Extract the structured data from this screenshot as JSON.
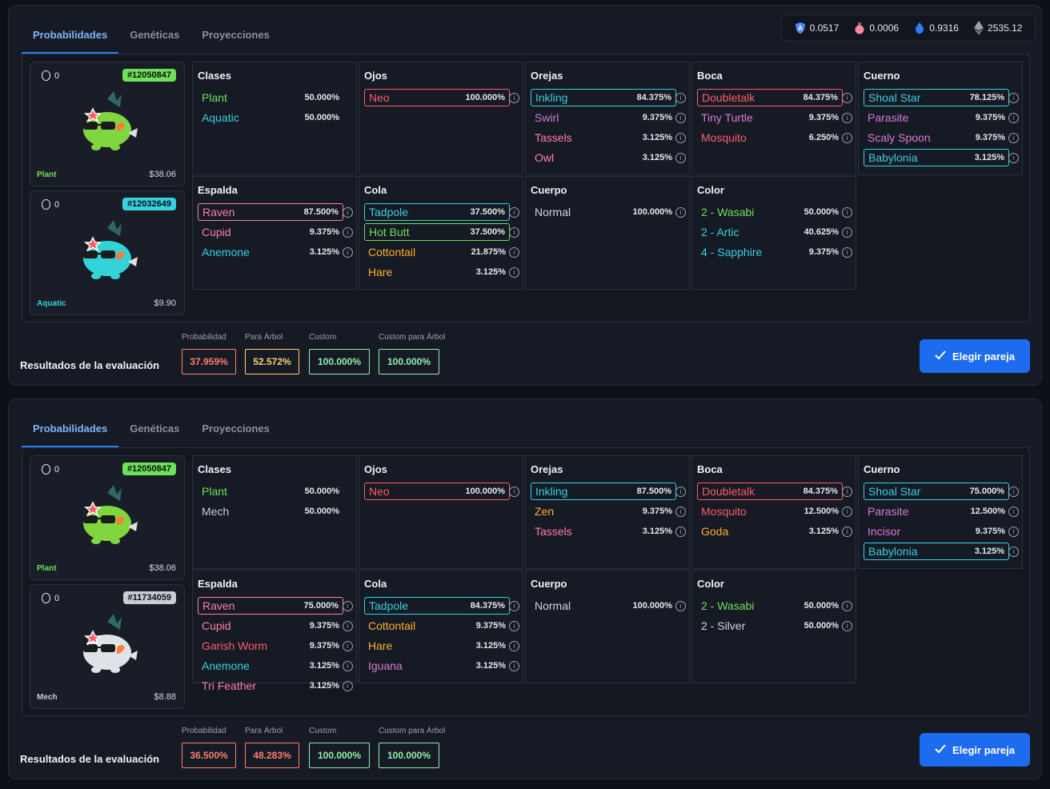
{
  "tokens": [
    {
      "icon": "axs-shield-icon",
      "value": "0.0517",
      "color": "#4a8cff"
    },
    {
      "icon": "slp-potion-icon",
      "value": "0.0006",
      "color": "#f28aa0"
    },
    {
      "icon": "ron-drop-icon",
      "value": "0.9316",
      "color": "#2d7bf0"
    },
    {
      "icon": "eth-diamond-icon",
      "value": "2535.12",
      "color": "#9aa0ad"
    }
  ],
  "colors": {
    "Plant": "#6ee05a",
    "Aquatic": "#36d2e0",
    "Reptile": "#d77ad8",
    "Bird": "#ff7fa8",
    "Beast": "#ffb02e",
    "Bug": "#ff5c66",
    "Mech": "#c9ccd3",
    "Neutral": "#d4d7df",
    "accent": "#2d7bf0"
  },
  "panels": [
    {
      "tabs": [
        "Probabilidades",
        "Genéticas",
        "Proyecciones"
      ],
      "active_tab": 0,
      "axies": [
        {
          "count": "0",
          "id": "#12050847",
          "id_color": "#6ee05a",
          "cls": "Plant",
          "price": "$38.06",
          "body_color": "#7fd63f"
        },
        {
          "count": "0",
          "id": "#12032649",
          "id_color": "#36d2e0",
          "cls": "Aquatic",
          "price": "$9.90",
          "body_color": "#34d3d9"
        }
      ],
      "parts": [
        {
          "title": "Clases",
          "rows": [
            {
              "name": "Plant",
              "pct": "50.000%",
              "cls": "Plant",
              "boxed": false,
              "info": false
            },
            {
              "name": "Aquatic",
              "pct": "50.000%",
              "cls": "Aquatic",
              "boxed": false,
              "info": false
            }
          ]
        },
        {
          "title": "Ojos",
          "rows": [
            {
              "name": "Neo",
              "pct": "100.000%",
              "cls": "Bug",
              "boxed": true,
              "info": true
            }
          ]
        },
        {
          "title": "Orejas",
          "rows": [
            {
              "name": "Inkling",
              "pct": "84.375%",
              "cls": "Aquatic",
              "boxed": true,
              "info": true
            },
            {
              "name": "Swirl",
              "pct": "9.375%",
              "cls": "Reptile",
              "boxed": false,
              "info": true
            },
            {
              "name": "Tassels",
              "pct": "3.125%",
              "cls": "Bird",
              "boxed": false,
              "info": true
            },
            {
              "name": "Owl",
              "pct": "3.125%",
              "cls": "Bird",
              "boxed": false,
              "info": true
            }
          ]
        },
        {
          "title": "Boca",
          "rows": [
            {
              "name": "Doubletalk",
              "pct": "84.375%",
              "cls": "Bug",
              "boxed": true,
              "info": true
            },
            {
              "name": "Tiny Turtle",
              "pct": "9.375%",
              "cls": "Reptile",
              "boxed": false,
              "info": true
            },
            {
              "name": "Mosquito",
              "pct": "6.250%",
              "cls": "Bug",
              "boxed": false,
              "info": true
            }
          ]
        },
        {
          "title": "Cuerno",
          "rows": [
            {
              "name": "Shoal Star",
              "pct": "78.125%",
              "cls": "Aquatic",
              "boxed": true,
              "info": true
            },
            {
              "name": "Parasite",
              "pct": "9.375%",
              "cls": "Reptile",
              "boxed": false,
              "info": true
            },
            {
              "name": "Scaly Spoon",
              "pct": "9.375%",
              "cls": "Reptile",
              "boxed": false,
              "info": true
            },
            {
              "name": "Babylonia",
              "pct": "3.125%",
              "cls": "Aquatic",
              "boxed": true,
              "info": true
            }
          ]
        },
        {
          "title": "Espalda",
          "rows": [
            {
              "name": "Raven",
              "pct": "87.500%",
              "cls": "Bird",
              "boxed": true,
              "info": true
            },
            {
              "name": "Cupid",
              "pct": "9.375%",
              "cls": "Bird",
              "boxed": false,
              "info": true
            },
            {
              "name": "Anemone",
              "pct": "3.125%",
              "cls": "Aquatic",
              "boxed": false,
              "info": true
            }
          ]
        },
        {
          "title": "Cola",
          "rows": [
            {
              "name": "Tadpole",
              "pct": "37.500%",
              "cls": "Aquatic",
              "boxed": true,
              "info": true
            },
            {
              "name": "Hot Butt",
              "pct": "37.500%",
              "cls": "Plant",
              "boxed": true,
              "info": true
            },
            {
              "name": "Cottontail",
              "pct": "21.875%",
              "cls": "Beast",
              "boxed": false,
              "info": true
            },
            {
              "name": "Hare",
              "pct": "3.125%",
              "cls": "Beast",
              "boxed": false,
              "info": true
            }
          ]
        },
        {
          "title": "Cuerpo",
          "rows": [
            {
              "name": "Normal",
              "pct": "100.000%",
              "cls": "Neutral",
              "boxed": false,
              "info": true
            }
          ]
        },
        {
          "title": "Color",
          "rows": [
            {
              "name": "2 - Wasabi",
              "pct": "50.000%",
              "cls": "Plant",
              "boxed": false,
              "info": true
            },
            {
              "name": "2 - Artic",
              "pct": "40.625%",
              "cls": "Aquatic",
              "boxed": false,
              "info": true
            },
            {
              "name": "4 - Sapphire",
              "pct": "9.375%",
              "cls": "Aquatic",
              "boxed": false,
              "info": true
            }
          ]
        }
      ],
      "results_label": "Resultados de la evaluación",
      "metrics": [
        {
          "label": "Probabilidad",
          "value": "37.959%",
          "color": "#ff7f6a"
        },
        {
          "label": "Para Árbol",
          "value": "52.572%",
          "color": "#ffcf6b"
        },
        {
          "label": "Custom",
          "value": "100.000%",
          "color": "#8ff0a8"
        },
        {
          "label": "Custom para Árbol",
          "value": "100.000%",
          "color": "#8ff0a8"
        }
      ],
      "button": "Elegir pareja"
    },
    {
      "tabs": [
        "Probabilidades",
        "Genéticas",
        "Proyecciones"
      ],
      "active_tab": 0,
      "axies": [
        {
          "count": "0",
          "id": "#12050847",
          "id_color": "#6ee05a",
          "cls": "Plant",
          "price": "$38.06",
          "body_color": "#7fd63f"
        },
        {
          "count": "0",
          "id": "#11734059",
          "id_color": "#c9ccd3",
          "cls": "Mech",
          "price": "$8.88",
          "body_color": "#dde3e6"
        }
      ],
      "parts": [
        {
          "title": "Clases",
          "rows": [
            {
              "name": "Plant",
              "pct": "50.000%",
              "cls": "Plant",
              "boxed": false,
              "info": false
            },
            {
              "name": "Mech",
              "pct": "50.000%",
              "cls": "Mech",
              "boxed": false,
              "info": false
            }
          ]
        },
        {
          "title": "Ojos",
          "rows": [
            {
              "name": "Neo",
              "pct": "100.000%",
              "cls": "Bug",
              "boxed": true,
              "info": true
            }
          ]
        },
        {
          "title": "Orejas",
          "rows": [
            {
              "name": "Inkling",
              "pct": "87.500%",
              "cls": "Aquatic",
              "boxed": true,
              "info": true
            },
            {
              "name": "Zen",
              "pct": "9.375%",
              "cls": "Beast",
              "boxed": false,
              "info": true
            },
            {
              "name": "Tassels",
              "pct": "3.125%",
              "cls": "Bird",
              "boxed": false,
              "info": true
            }
          ]
        },
        {
          "title": "Boca",
          "rows": [
            {
              "name": "Doubletalk",
              "pct": "84.375%",
              "cls": "Bug",
              "boxed": true,
              "info": true
            },
            {
              "name": "Mosquito",
              "pct": "12.500%",
              "cls": "Bug",
              "boxed": false,
              "info": true
            },
            {
              "name": "Goda",
              "pct": "3.125%",
              "cls": "Beast",
              "boxed": false,
              "info": true
            }
          ]
        },
        {
          "title": "Cuerno",
          "rows": [
            {
              "name": "Shoal Star",
              "pct": "75.000%",
              "cls": "Aquatic",
              "boxed": true,
              "info": true
            },
            {
              "name": "Parasite",
              "pct": "12.500%",
              "cls": "Reptile",
              "boxed": false,
              "info": true
            },
            {
              "name": "Incisor",
              "pct": "9.375%",
              "cls": "Reptile",
              "boxed": false,
              "info": true
            },
            {
              "name": "Babylonia",
              "pct": "3.125%",
              "cls": "Aquatic",
              "boxed": true,
              "info": true
            }
          ]
        },
        {
          "title": "Espalda",
          "rows": [
            {
              "name": "Raven",
              "pct": "75.000%",
              "cls": "Bird",
              "boxed": true,
              "info": true
            },
            {
              "name": "Cupid",
              "pct": "9.375%",
              "cls": "Bird",
              "boxed": false,
              "info": true
            },
            {
              "name": "Garish Worm",
              "pct": "9.375%",
              "cls": "Bug",
              "boxed": false,
              "info": true
            },
            {
              "name": "Anemone",
              "pct": "3.125%",
              "cls": "Aquatic",
              "boxed": false,
              "info": true
            },
            {
              "name": "Tri Feather",
              "pct": "3.125%",
              "cls": "Bird",
              "boxed": false,
              "info": true
            }
          ]
        },
        {
          "title": "Cola",
          "rows": [
            {
              "name": "Tadpole",
              "pct": "84.375%",
              "cls": "Aquatic",
              "boxed": true,
              "info": true
            },
            {
              "name": "Cottontail",
              "pct": "9.375%",
              "cls": "Beast",
              "boxed": false,
              "info": true
            },
            {
              "name": "Hare",
              "pct": "3.125%",
              "cls": "Beast",
              "boxed": false,
              "info": true
            },
            {
              "name": "Iguana",
              "pct": "3.125%",
              "cls": "Reptile",
              "boxed": false,
              "info": true
            }
          ]
        },
        {
          "title": "Cuerpo",
          "rows": [
            {
              "name": "Normal",
              "pct": "100.000%",
              "cls": "Neutral",
              "boxed": false,
              "info": true
            }
          ]
        },
        {
          "title": "Color",
          "rows": [
            {
              "name": "2 - Wasabi",
              "pct": "50.000%",
              "cls": "Plant",
              "boxed": false,
              "info": true
            },
            {
              "name": "2 - Silver",
              "pct": "50.000%",
              "cls": "Neutral",
              "boxed": false,
              "info": true
            }
          ]
        }
      ],
      "results_label": "Resultados de la evaluación",
      "metrics": [
        {
          "label": "Probabilidad",
          "value": "36.500%",
          "color": "#ff7f6a"
        },
        {
          "label": "Para Árbol",
          "value": "48.283%",
          "color": "#ff7f6a"
        },
        {
          "label": "Custom",
          "value": "100.000%",
          "color": "#8ff0a8"
        },
        {
          "label": "Custom para Árbol",
          "value": "100.000%",
          "color": "#8ff0a8"
        }
      ],
      "button": "Elegir pareja"
    }
  ]
}
